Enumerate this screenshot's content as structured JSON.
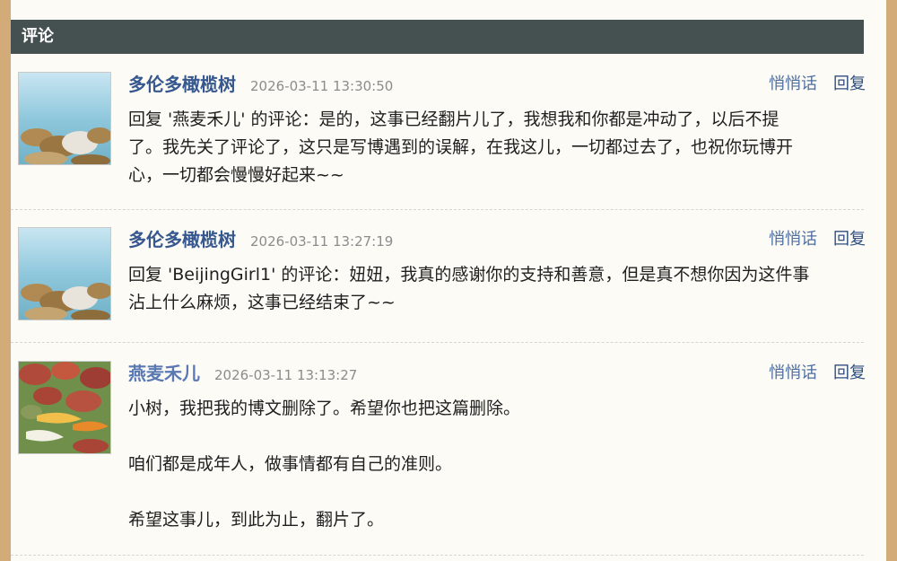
{
  "section": {
    "title": "评论"
  },
  "comments": [
    {
      "author": "多伦多橄榄树",
      "time": "2026-03-11 13:30:50",
      "whisper_label": "悄悄话",
      "reply_label": "回复",
      "avatar_icon": "lake-stones-avatar-icon",
      "lines": [
        "回复 '燕麦禾儿' 的评论：是的，这事已经翻片儿了，我想我和你都是冲动了，以后不提",
        "了。我先关了评论了，这只是写博遇到的误解，在我这儿，一切都过去了，也祝你玩博开",
        "心，一切都会慢慢好起来~~"
      ]
    },
    {
      "author": "多伦多橄榄树",
      "time": "2026-03-11 13:27:19",
      "whisper_label": "悄悄话",
      "reply_label": "回复",
      "avatar_icon": "lake-stones-avatar-icon",
      "lines": [
        "回复 'BeijingGirl1' 的评论：妞妞，我真的感谢你的支持和善意，但是真不想你因为这件事",
        "沾上什么麻烦，这事已经结束了~~"
      ]
    },
    {
      "author": "燕麦禾儿",
      "time": "2026-03-11 13:13:27",
      "whisper_label": "悄悄话",
      "reply_label": "回复",
      "avatar_icon": "koi-pond-avatar-icon",
      "paragraphs": [
        "小树，我把我的博文删除了。希望你也把这篇删除。",
        "咱们都是成年人，做事情都有自己的准则。",
        "希望这事儿，到此为止，翻片了。"
      ]
    }
  ]
}
